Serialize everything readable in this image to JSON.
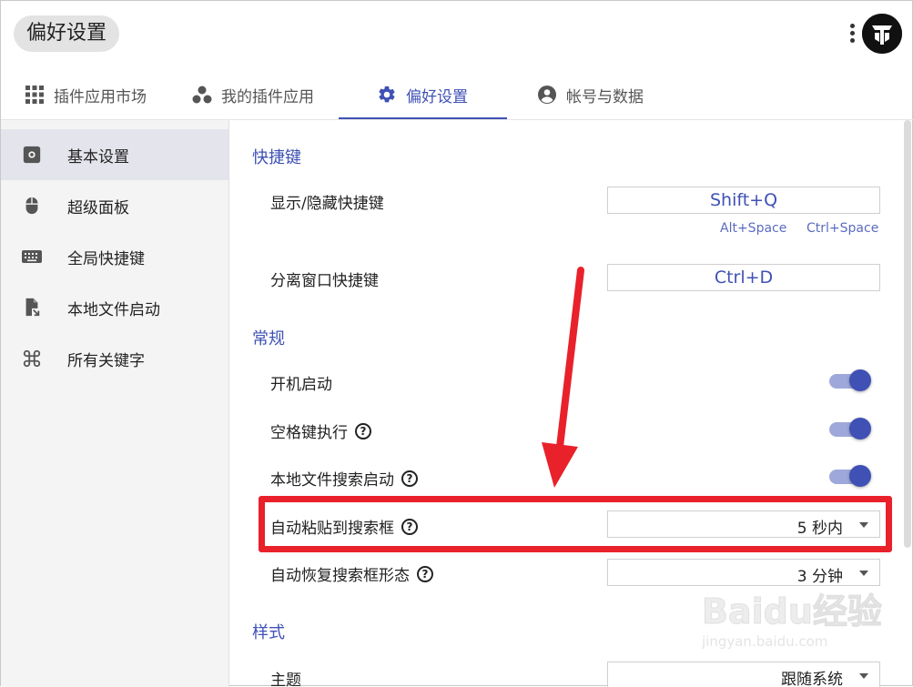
{
  "header": {
    "title": "偏好设置"
  },
  "tabs": [
    {
      "label": "插件应用市场",
      "icon": "grid-icon"
    },
    {
      "label": "我的插件应用",
      "icon": "apps-cluster-icon"
    },
    {
      "label": "偏好设置",
      "icon": "gear-icon",
      "active": true
    },
    {
      "label": "帐号与数据",
      "icon": "account-icon"
    }
  ],
  "sidebar": {
    "items": [
      {
        "label": "基本设置",
        "icon": "settings-box-icon",
        "active": true
      },
      {
        "label": "超级面板",
        "icon": "mouse-icon"
      },
      {
        "label": "全局快捷键",
        "icon": "keyboard-icon"
      },
      {
        "label": "本地文件启动",
        "icon": "file-launch-icon"
      },
      {
        "label": "所有关键字",
        "icon": "command-key-icon"
      }
    ]
  },
  "sections": {
    "shortcuts": {
      "title": "快捷键",
      "show_hide_label": "显示/隐藏快捷键",
      "show_hide_value": "Shift+Q",
      "hint_alt": "Alt+Space",
      "hint_ctrl": "Ctrl+Space",
      "detach_label": "分离窗口快捷键",
      "detach_value": "Ctrl+D"
    },
    "general": {
      "title": "常规",
      "autostart_label": "开机启动",
      "space_exec_label": "空格键执行",
      "local_search_label": "本地文件搜索启动",
      "auto_paste_label": "自动粘贴到搜索框",
      "auto_paste_value": "5 秒内",
      "auto_restore_label": "自动恢复搜索框形态",
      "auto_restore_value": "3 分钟",
      "toggles_on": true
    },
    "style": {
      "title": "样式",
      "theme_label": "主题",
      "theme_value": "跟随系统"
    }
  },
  "watermark": {
    "brand": "Baidu经验",
    "url": "jingyan.baidu.com"
  },
  "colors": {
    "accent": "#3f51b5",
    "toggle_track": "#9fa8da",
    "highlight": "#e8212b"
  }
}
